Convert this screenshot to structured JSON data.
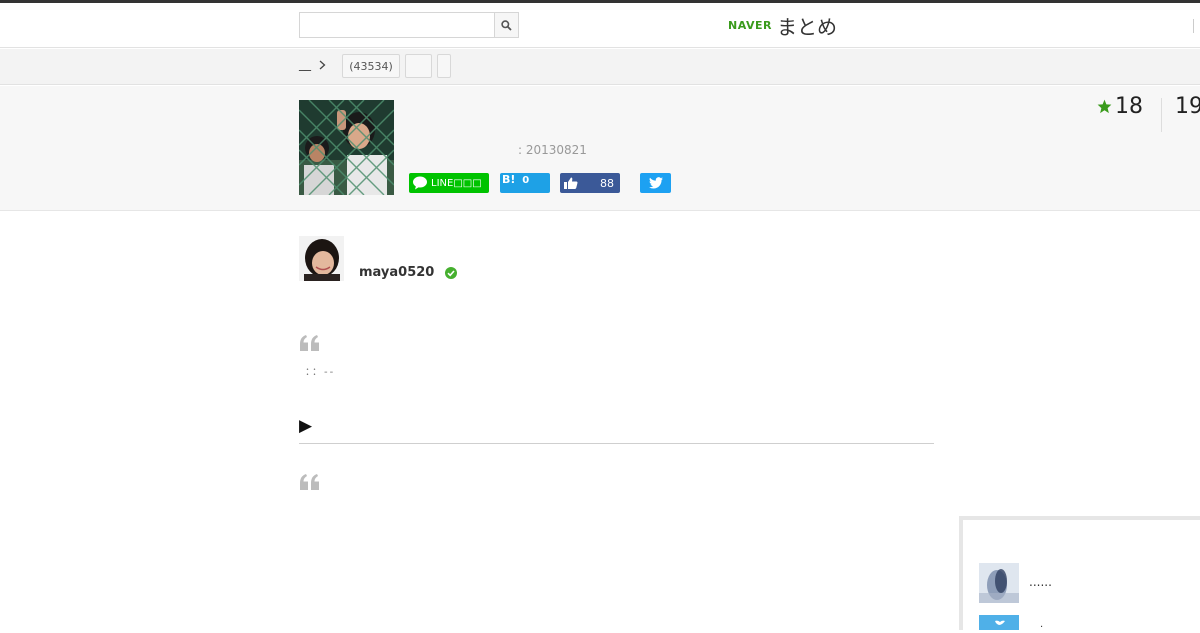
{
  "header": {
    "search": {
      "value": "",
      "placeholder": ""
    },
    "logo": {
      "brand": "NAVER",
      "product": "まとめ"
    }
  },
  "breadcrumb": {
    "home": "__",
    "tags": [
      "(43534)",
      "",
      ""
    ]
  },
  "info": {
    "updated": ": 20130821",
    "share": {
      "line_label": "LINE□□□",
      "hatena_label": "B!",
      "hatena_count": "0",
      "facebook_count": "88"
    },
    "favorites": "18",
    "views": "19"
  },
  "author": {
    "name": "maya0520"
  },
  "content": {
    "quote_text": "：：--",
    "link_marker": "▶"
  },
  "sidebar": {
    "items": [
      {
        "text": "......"
      },
      {
        "text": "·"
      }
    ]
  },
  "colors": {
    "naver_green": "#3a9b1c",
    "line_green": "#00c300",
    "hatena_blue": "#1ea1e6",
    "facebook_blue": "#3b5998",
    "twitter_blue": "#1da1f2",
    "verified_green": "#46b02f"
  }
}
